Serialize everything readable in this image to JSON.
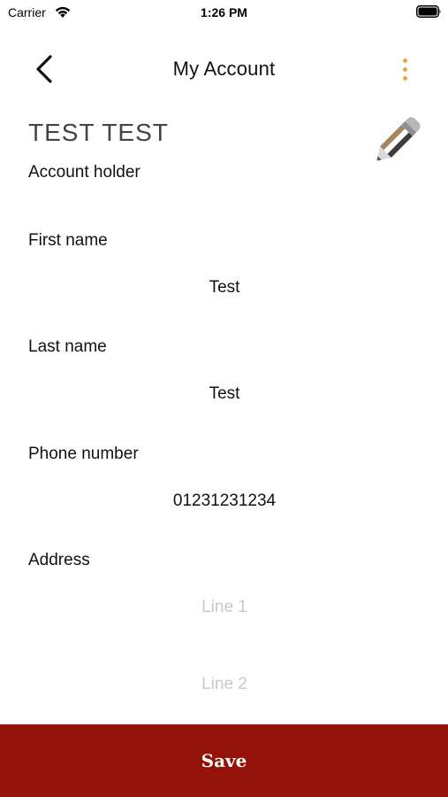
{
  "status_bar": {
    "carrier": "Carrier",
    "time": "1:26 PM",
    "icons": [
      "wifi-icon",
      "battery-icon"
    ]
  },
  "nav": {
    "title": "My Account",
    "back_icon": "chevron-left-icon",
    "more_icon": "more-vertical-icon"
  },
  "account": {
    "name": "TEST TEST",
    "subtitle": "Account holder",
    "edit_icon": "pencil-icon"
  },
  "fields": {
    "first_name": {
      "label": "First name",
      "value": "Test"
    },
    "last_name": {
      "label": "Last name",
      "value": "Test"
    },
    "phone": {
      "label": "Phone number",
      "value": "01231231234"
    },
    "address": {
      "label": "Address",
      "line1_placeholder": "Line 1",
      "line2_placeholder": "Line 2"
    }
  },
  "save": {
    "label": "Save"
  },
  "colors": {
    "accent": "#e3a83a",
    "save_bg": "#931209",
    "placeholder": "#c9c9c9",
    "text": "#111111"
  }
}
